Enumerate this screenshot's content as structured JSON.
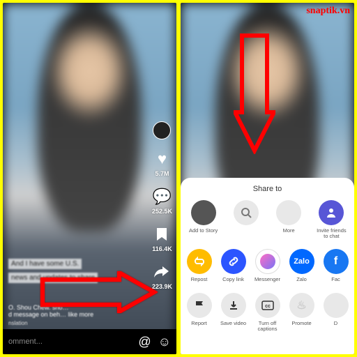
{
  "watermark": "snaptik.vn",
  "left": {
    "likes": "5.7M",
    "comments": "252.5K",
    "saves": "116.4K",
    "shares": "223.9K",
    "caption_line1": "And I have some U.S.",
    "caption_line2": "news and updates to share",
    "username_line": "O. Shou Chew. sho…",
    "meta_line": "d message on beh…",
    "more": "like more",
    "see_translation": "nslation",
    "comment_placeholder": "omment..."
  },
  "right": {
    "share_to": "Share to",
    "row1": {
      "story": "Add to Story",
      "search": "",
      "more": "More",
      "invite": "Invite friends to chat"
    },
    "row2": {
      "repost": "Repost",
      "copy": "Copy link",
      "messenger": "Messenger",
      "zalo": "Zalo",
      "zalo_text": "Zalo",
      "fb": "Fac"
    },
    "row3": {
      "report": "Report",
      "save": "Save video",
      "captions": "Turn off captions",
      "promote": "Promote",
      "d": "D"
    }
  }
}
